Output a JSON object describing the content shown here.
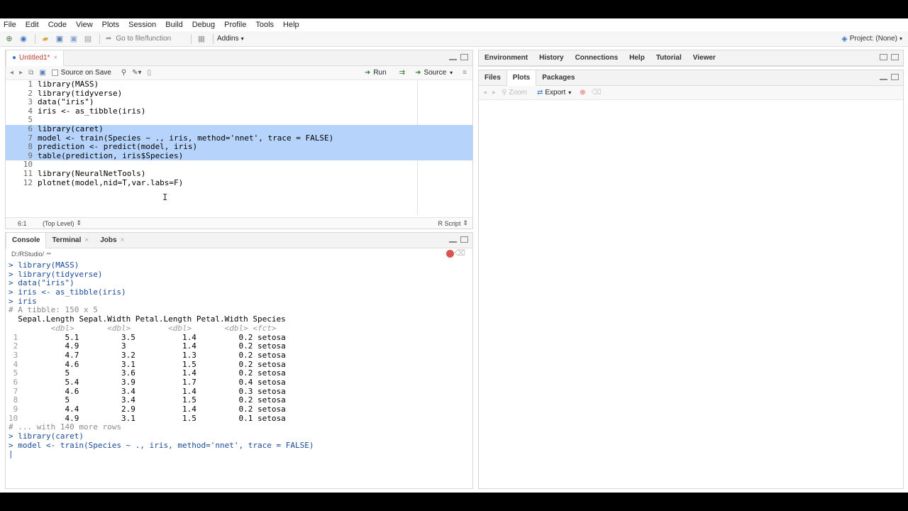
{
  "menu": [
    "File",
    "Edit",
    "Code",
    "View",
    "Plots",
    "Session",
    "Build",
    "Debug",
    "Profile",
    "Tools",
    "Help"
  ],
  "toolbar": {
    "goto_placeholder": "Go to file/function",
    "addins": "Addins",
    "project": "Project: (None)"
  },
  "editor": {
    "tab_title": "Untitled1*",
    "source_on_save": "Source on Save",
    "run": "Run",
    "source": "Source",
    "lines": [
      {
        "n": "1",
        "text": "library(MASS)"
      },
      {
        "n": "2",
        "text": "library(tidyverse)"
      },
      {
        "n": "3",
        "text": "data(\"iris\")"
      },
      {
        "n": "4",
        "text": "iris <- as_tibble(iris)"
      },
      {
        "n": "5",
        "text": ""
      },
      {
        "n": "6",
        "text": "library(caret)"
      },
      {
        "n": "7",
        "text": "model <- train(Species ~ ., iris, method='nnet', trace = FALSE)"
      },
      {
        "n": "8",
        "text": "prediction <- predict(model, iris)"
      },
      {
        "n": "9",
        "text": "table(prediction, iris$Species)"
      },
      {
        "n": "10",
        "text": ""
      },
      {
        "n": "11",
        "text": "library(NeuralNetTools)"
      },
      {
        "n": "12",
        "text": "plotnet(model,nid=T,var.labs=F)"
      }
    ],
    "status_pos": "6:1",
    "status_scope": "(Top Level)",
    "status_type": "R Script"
  },
  "console": {
    "tabs": [
      "Console",
      "Terminal",
      "Jobs"
    ],
    "path": "D:/RStudio/",
    "lines": [
      {
        "cls": "cmd",
        "text": "> library(MASS)"
      },
      {
        "cls": "cmd",
        "text": "> library(tidyverse)"
      },
      {
        "cls": "cmd",
        "text": "> data(\"iris\")"
      },
      {
        "cls": "cmd",
        "text": "> iris <- as_tibble(iris)"
      },
      {
        "cls": "cmd",
        "text": "> iris"
      },
      {
        "cls": "cmt",
        "text": "# A tibble: 150 x 5"
      },
      {
        "cls": "out",
        "text": "  Sepal.Length Sepal.Width Petal.Length Petal.Width Species"
      },
      {
        "cls": "typ",
        "text": "         <dbl>       <dbl>        <dbl>       <dbl> <fct>"
      },
      {
        "cls": "row",
        "rn": " 1",
        "text": "          5.1         3.5          1.4         0.2 setosa"
      },
      {
        "cls": "row",
        "rn": " 2",
        "text": "          4.9         3            1.4         0.2 setosa"
      },
      {
        "cls": "row",
        "rn": " 3",
        "text": "          4.7         3.2          1.3         0.2 setosa"
      },
      {
        "cls": "row",
        "rn": " 4",
        "text": "          4.6         3.1          1.5         0.2 setosa"
      },
      {
        "cls": "row",
        "rn": " 5",
        "text": "          5           3.6          1.4         0.2 setosa"
      },
      {
        "cls": "row",
        "rn": " 6",
        "text": "          5.4         3.9          1.7         0.4 setosa"
      },
      {
        "cls": "row",
        "rn": " 7",
        "text": "          4.6         3.4          1.4         0.3 setosa"
      },
      {
        "cls": "row",
        "rn": " 8",
        "text": "          5           3.4          1.5         0.2 setosa"
      },
      {
        "cls": "row",
        "rn": " 9",
        "text": "          4.4         2.9          1.4         0.2 setosa"
      },
      {
        "cls": "row",
        "rn": "10",
        "text": "          4.9         3.1          1.5         0.1 setosa"
      },
      {
        "cls": "cmt",
        "text": "# ... with 140 more rows"
      },
      {
        "cls": "cmd",
        "text": "> library(caret)"
      },
      {
        "cls": "cmd",
        "text": "> model <- train(Species ~ ., iris, method='nnet', trace = FALSE)"
      },
      {
        "cls": "cmd",
        "text": "|"
      }
    ]
  },
  "env_tabs": [
    "Environment",
    "History",
    "Connections",
    "Help",
    "Tutorial",
    "Viewer"
  ],
  "files_tabs": [
    "Files",
    "Plots",
    "Packages"
  ],
  "plots_toolbar": {
    "zoom": "Zoom",
    "export": "Export"
  },
  "colors": {
    "selection": "#b6d3fb",
    "console_input": "#1a4a9a",
    "accent": "#3a78c2"
  }
}
